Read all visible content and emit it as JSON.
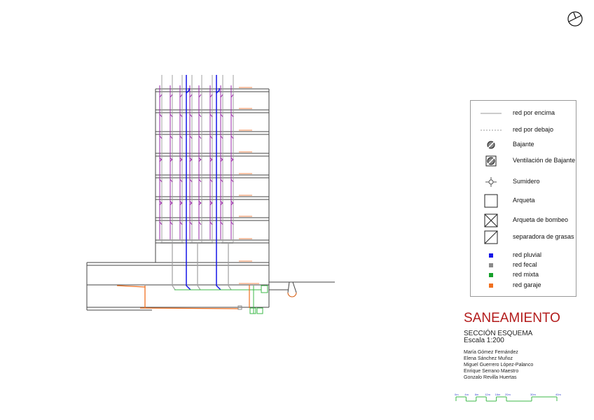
{
  "legend": {
    "items": [
      {
        "symbol": "solid-line",
        "label": "red por encima"
      },
      {
        "symbol": "dashed-line",
        "label": "red por debajo"
      },
      {
        "symbol": "bajante-icon",
        "label": "Bajante"
      },
      {
        "symbol": "ventilacion-icon",
        "label": "Ventilación de Bajante"
      },
      {
        "symbol": "sumidero-icon",
        "label": "Sumidero"
      },
      {
        "symbol": "arqueta-icon",
        "label": "Arqueta"
      },
      {
        "symbol": "arqueta-bombeo-icon",
        "label": "Arqueta de bombeo"
      },
      {
        "symbol": "separadora-icon",
        "label": "separadora de grasas"
      },
      {
        "symbol": "swatch",
        "label": "red pluvial",
        "color": "#1515e8"
      },
      {
        "symbol": "swatch",
        "label": "red fecal",
        "color": "#8a8a8a"
      },
      {
        "symbol": "swatch",
        "label": "red mixta",
        "color": "#16a02a"
      },
      {
        "symbol": "swatch",
        "label": "red garaje",
        "color": "#f07020"
      }
    ]
  },
  "title_block": {
    "title": "SANEAMIENTO",
    "subtitle": "SECCIÓN ESQUEMA",
    "scale": "Escala 1:200",
    "authors": [
      "María Gómez Fernández",
      "Elena Sánchez Muñoz",
      "Miguel Guerrero López-Palanco",
      "Enrique Serrano Maestro",
      "Gonzalo Revilla Huertas"
    ]
  },
  "scale_bar": {
    "labels": [
      "0m",
      "4m",
      "8m",
      "12m",
      "16m",
      "20m",
      "30m",
      "40m"
    ],
    "values_m": [
      0,
      4,
      8,
      12,
      16,
      20,
      30,
      40
    ]
  },
  "colors": {
    "pluvial": "#1515e8",
    "fecal": "#9a9a9a",
    "mixta": "#3cb84a",
    "garaje": "#f07020",
    "ventilacion": "#9a2aa8",
    "title": "#b31b1b"
  }
}
